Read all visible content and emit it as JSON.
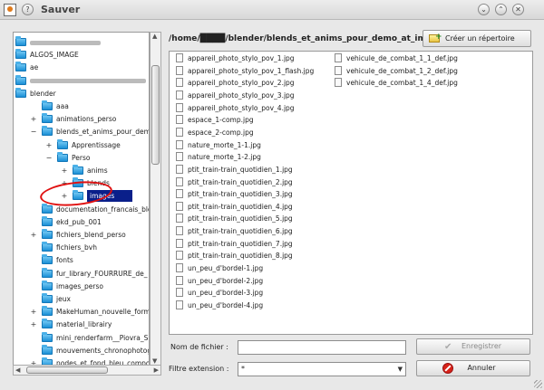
{
  "window": {
    "title": "Sauver"
  },
  "titlebar_buttons": [
    "?",
    "⌄",
    "⌃",
    "✕"
  ],
  "path": "/home/████/blender/blends_et_anims_pour_demo_at_im",
  "create_dir_label": "Créer un répertoire",
  "tree": [
    {
      "label": "",
      "blurred": 78,
      "exp": "",
      "indent": 0
    },
    {
      "label": "ALGOS_IMAGE",
      "exp": "",
      "indent": 0
    },
    {
      "label": "ae",
      "exp": "",
      "indent": 0
    },
    {
      "label": "",
      "blurred": 128,
      "exp": "",
      "indent": 0
    },
    {
      "label": "blender",
      "exp": "−",
      "indent": 0
    },
    {
      "label": "aaa",
      "exp": "",
      "indent": 1
    },
    {
      "label": "animations_perso",
      "exp": "+",
      "indent": 1
    },
    {
      "label": "blends_et_anims_pour_dem",
      "exp": "−",
      "indent": 1
    },
    {
      "label": "Apprentissage",
      "exp": "+",
      "indent": 2
    },
    {
      "label": "Perso",
      "exp": "−",
      "indent": 2
    },
    {
      "label": "anims",
      "exp": "+",
      "indent": 3
    },
    {
      "label": "blends",
      "exp": "+",
      "indent": 3
    },
    {
      "label": "images",
      "exp": "+",
      "indent": 3,
      "selected": true
    },
    {
      "label": "documentation_francais_ble",
      "exp": "",
      "indent": 1
    },
    {
      "label": "ekd_pub_001",
      "exp": "",
      "indent": 1
    },
    {
      "label": "fichiers_blend_perso",
      "exp": "+",
      "indent": 1
    },
    {
      "label": "fichiers_bvh",
      "exp": "",
      "indent": 1
    },
    {
      "label": "fonts",
      "exp": "",
      "indent": 1
    },
    {
      "label": "fur_library_FOURRURE_de_",
      "exp": "",
      "indent": 1
    },
    {
      "label": "images_perso",
      "exp": "",
      "indent": 1
    },
    {
      "label": "jeux",
      "exp": "",
      "indent": 1
    },
    {
      "label": "MakeHuman_nouvelle_form",
      "exp": "+",
      "indent": 1
    },
    {
      "label": "material_librairy",
      "exp": "+",
      "indent": 1
    },
    {
      "label": "mini_renderfarm__Piovra_S",
      "exp": "",
      "indent": 1
    },
    {
      "label": "mouvements_chronophotog",
      "exp": "",
      "indent": 1
    },
    {
      "label": "nodes_et_fond_bleu_compo",
      "exp": "+",
      "indent": 1
    }
  ],
  "files_col1": [
    "appareil_photo_stylo_pov_1.jpg",
    "appareil_photo_stylo_pov_1_flash.jpg",
    "appareil_photo_stylo_pov_2.jpg",
    "appareil_photo_stylo_pov_3.jpg",
    "appareil_photo_stylo_pov_4.jpg",
    "espace_1-comp.jpg",
    "espace_2-comp.jpg",
    "nature_morte_1-1.jpg",
    "nature_morte_1-2.jpg",
    "ptit_train-train_quotidien_1.jpg",
    "ptit_train-train_quotidien_2.jpg",
    "ptit_train-train_quotidien_3.jpg",
    "ptit_train-train_quotidien_4.jpg",
    "ptit_train-train_quotidien_5.jpg",
    "ptit_train-train_quotidien_6.jpg",
    "ptit_train-train_quotidien_7.jpg",
    "ptit_train-train_quotidien_8.jpg",
    "un_peu_d'bordel-1.jpg",
    "un_peu_d'bordel-2.jpg",
    "un_peu_d'bordel-3.jpg",
    "un_peu_d'bordel-4.jpg"
  ],
  "files_col2": [
    "vehicule_de_combat_1_1_def.jpg",
    "vehicule_de_combat_1_2_def.jpg",
    "vehicule_de_combat_1_4_def.jpg"
  ],
  "form": {
    "filename_label": "Nom de fichier :",
    "filename_value": "",
    "filter_label": "Filtre extension :",
    "filter_value": "*",
    "save_label": "Enregistrer",
    "cancel_label": "Annuler"
  },
  "colors": {
    "selection": "#0a1f8a",
    "folder": "#1a8fd6",
    "annotation": "#e01010"
  }
}
